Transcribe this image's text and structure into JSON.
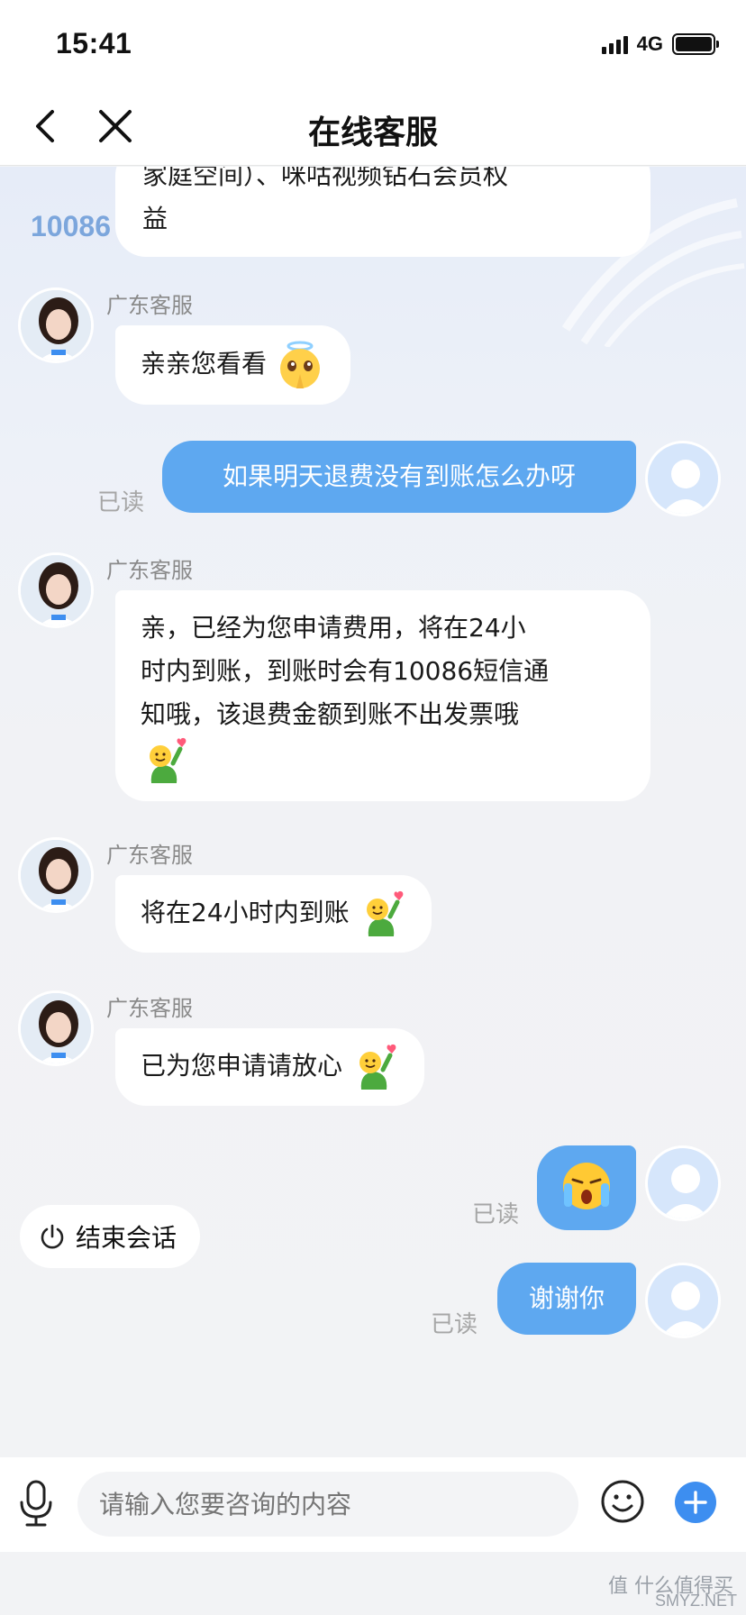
{
  "status_bar": {
    "time": "15:41",
    "network": "4G"
  },
  "nav": {
    "title": "在线客服"
  },
  "background": {
    "logo_text": "10086"
  },
  "messages": {
    "m0": {
      "line1": "家庭空间）、咪咕视频钻石会员权",
      "line2": "益"
    },
    "m1": {
      "agent": "广东客服",
      "text": "亲亲您看看"
    },
    "m2": {
      "text": "如果明天退费没有到账怎么办呀",
      "read": "已读"
    },
    "m3": {
      "agent": "广东客服",
      "line1": "亲，已经为您申请费用，将在24小",
      "line2": "时内到账，到账时会有10086短信通",
      "line3": "知哦，该退费金额到账不出发票哦"
    },
    "m4": {
      "agent": "广东客服",
      "text": "将在24小时内到账"
    },
    "m5": {
      "agent": "广东客服",
      "text": "已为您申请请放心"
    },
    "m6": {
      "read": "已读",
      "emoji": "crying-emoji"
    },
    "m7": {
      "text": "谢谢你",
      "read": "已读"
    }
  },
  "end_session": {
    "label": "结束会话"
  },
  "input": {
    "placeholder": "请输入您要咨询的内容"
  },
  "watermark": {
    "text": "值 什么值得买",
    "sub": "SMYZ.NET"
  },
  "colors": {
    "user_bubble": "#5ea8f0",
    "agent_bubble": "#ffffff",
    "plus_button": "#3d8ef0"
  }
}
